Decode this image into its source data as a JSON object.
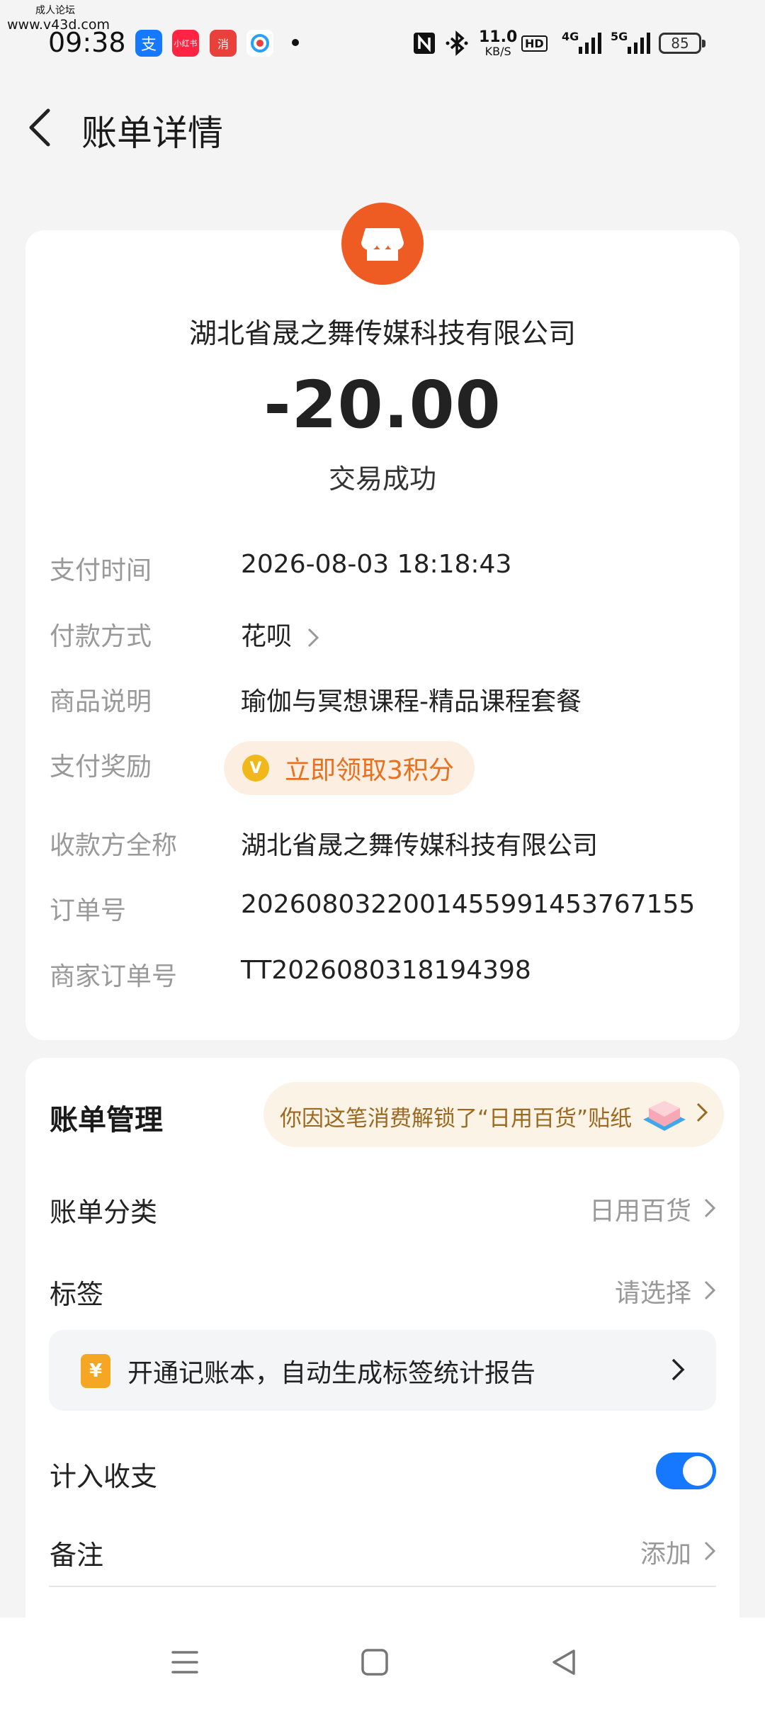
{
  "status_bar": {
    "watermark_top": "成人论坛",
    "watermark": "www.v43d.com",
    "time": "09:38",
    "apps": [
      {
        "name": "alipay-app-icon",
        "glyph": "支",
        "color": "#1677ff"
      },
      {
        "name": "xiaohongshu-app-icon",
        "glyph": "小红书",
        "color": "#ff2442"
      },
      {
        "name": "game-app-icon",
        "glyph": "消",
        "color": "#e8403a"
      },
      {
        "name": "browser-app-icon",
        "glyph": "",
        "color": "#ffffff"
      }
    ],
    "network_speed_value": "11.0",
    "network_speed_unit": "KB/S",
    "hd_label": "HD",
    "net_4g": "4G",
    "net_5g": "5G",
    "battery": "85"
  },
  "header": {
    "title": "账单详情"
  },
  "bill": {
    "merchant": "湖北省晟之舞传媒科技有限公司",
    "amount": "-20.00",
    "status": "交易成功",
    "details": [
      {
        "label": "支付时间",
        "value": "2026-08-03 18:18:43"
      },
      {
        "label": "付款方式",
        "value": "花呗"
      },
      {
        "label": "商品说明",
        "value": "瑜伽与冥想课程-精品课程套餐"
      },
      {
        "label": "支付奖励",
        "value": "立即领取3积分"
      },
      {
        "label": "收款方全称",
        "value": "湖北省晟之舞传媒科技有限公司"
      },
      {
        "label": "订单号",
        "value": "2026080322001455991453767155"
      },
      {
        "label": "商家订单号",
        "value": "TT2026080318194398"
      }
    ]
  },
  "management": {
    "title": "账单管理",
    "sticker_text": "你因这笔消费解锁了“日用百货”贴纸",
    "category_label": "账单分类",
    "category_value": "日用百货",
    "tag_label": "标签",
    "tag_value": "请选择",
    "ledger_icon": "¥",
    "ledger_text": "开通记账本，自动生成标签统计报告",
    "include_label": "计入收支",
    "include_enabled": true,
    "note_label": "备注",
    "note_value": "添加"
  },
  "colors": {
    "accent_blue": "#1677ff",
    "merchant_orange": "#ee5c24",
    "reward_orange": "#e8701f",
    "background": "#f4f4f4"
  }
}
